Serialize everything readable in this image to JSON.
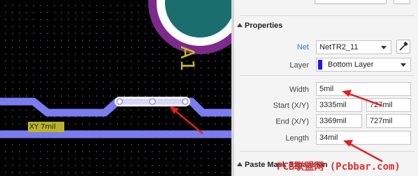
{
  "canvas": {
    "designator": "A1",
    "xy_readout": "XY 7mil",
    "colors": {
      "trace": "#7b7cf0",
      "selected_trace": "#ffffff",
      "component_ring": "#7d2a8c",
      "component_fill": "#1a6e6e",
      "arrow": "#e02020"
    }
  },
  "panel": {
    "properties_header": "Properties",
    "net_label": "Net",
    "net_value": "NetTR2_11",
    "layer_label": "Layer",
    "layer_value": "Bottom Layer",
    "layer_color": "#1a1aff",
    "width_label": "Width",
    "width_value": "5mil",
    "start_label": "Start (X/Y)",
    "start_x": "3335mil",
    "start_y": "727mil",
    "end_label": "End (X/Y)",
    "end_x": "3369mil",
    "end_y": "727mil",
    "length_label": "Length",
    "length_value": "34mil",
    "paste_mask_header": "Paste Mask Expansion",
    "picker_icon": "eyedropper-icon"
  },
  "watermark": "PCB联盟网 (Pcbbar.com)"
}
